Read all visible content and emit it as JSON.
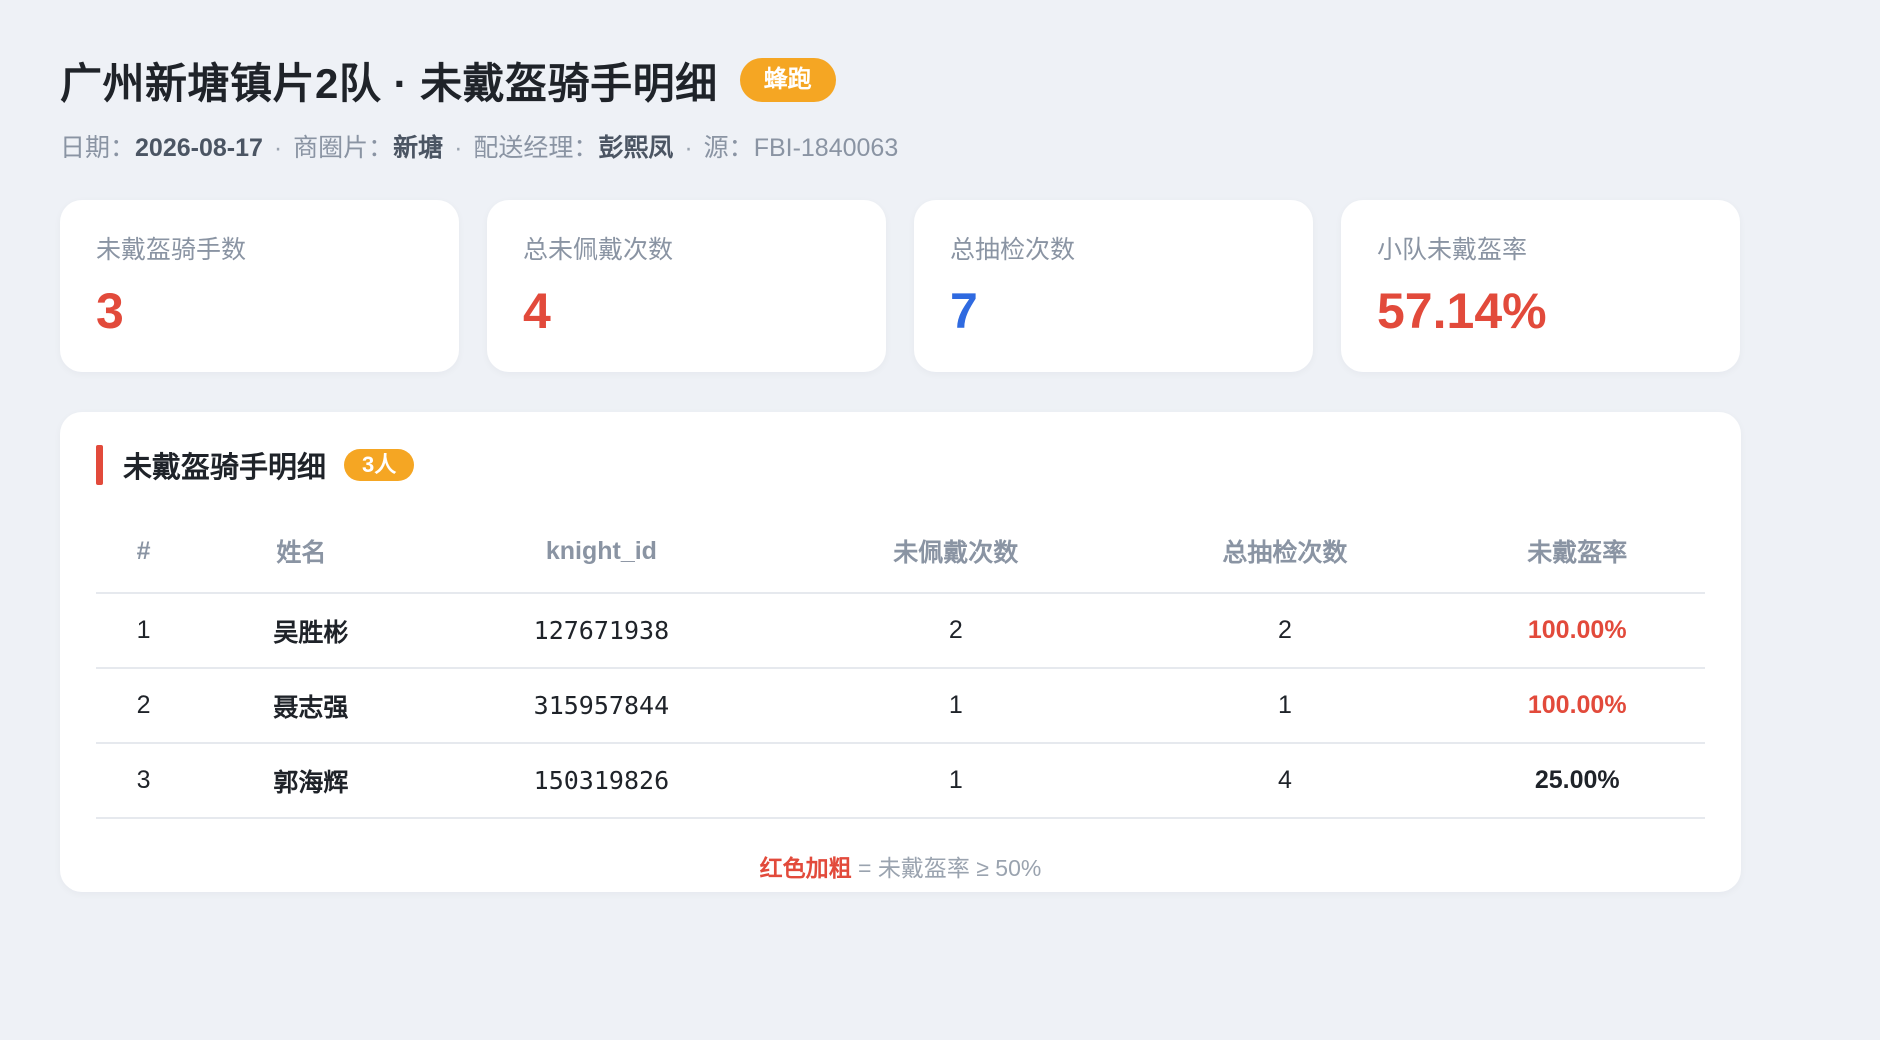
{
  "header": {
    "title": "广州新塘镇片2队 · 未戴盔骑手明细",
    "brand_badge": "蜂跑"
  },
  "meta": {
    "date_label": "日期：",
    "date": "2026-08-17",
    "sep": "·",
    "area_label": "商圈片：",
    "area": "新塘",
    "manager_label": "配送经理：",
    "manager": "彭熙凤",
    "source_label": "源：",
    "source": "FBI-1840063"
  },
  "kpis": [
    {
      "label": "未戴盔骑手数",
      "value": "3",
      "color": "#e24a3b"
    },
    {
      "label": "总未佩戴次数",
      "value": "4",
      "color": "#e24a3b"
    },
    {
      "label": "总抽检次数",
      "value": "7",
      "color": "#2f6ae0"
    },
    {
      "label": "小队未戴盔率",
      "value": "57.14%",
      "color": "#e24a3b"
    }
  ],
  "detail": {
    "title": "未戴盔骑手明细",
    "count_badge": "3人",
    "columns": [
      "#",
      "姓名",
      "knight_id",
      "未佩戴次数",
      "总抽检次数",
      "未戴盔率"
    ],
    "rows": [
      {
        "idx": "1",
        "name": "吴胜彬",
        "knight_id": "127671938",
        "missed": "2",
        "total": "2",
        "rate": "100.00%",
        "rate_color": "#e24a3b"
      },
      {
        "idx": "2",
        "name": "聂志强",
        "knight_id": "315957844",
        "missed": "1",
        "total": "1",
        "rate": "100.00%",
        "rate_color": "#e24a3b"
      },
      {
        "idx": "3",
        "name": "郭海辉",
        "knight_id": "150319826",
        "missed": "1",
        "total": "4",
        "rate": "25.00%",
        "rate_color": "#1f2329"
      }
    ],
    "legend_highlight": "红色加粗",
    "legend_rest": " = 未戴盔率 ≥ 50%"
  }
}
